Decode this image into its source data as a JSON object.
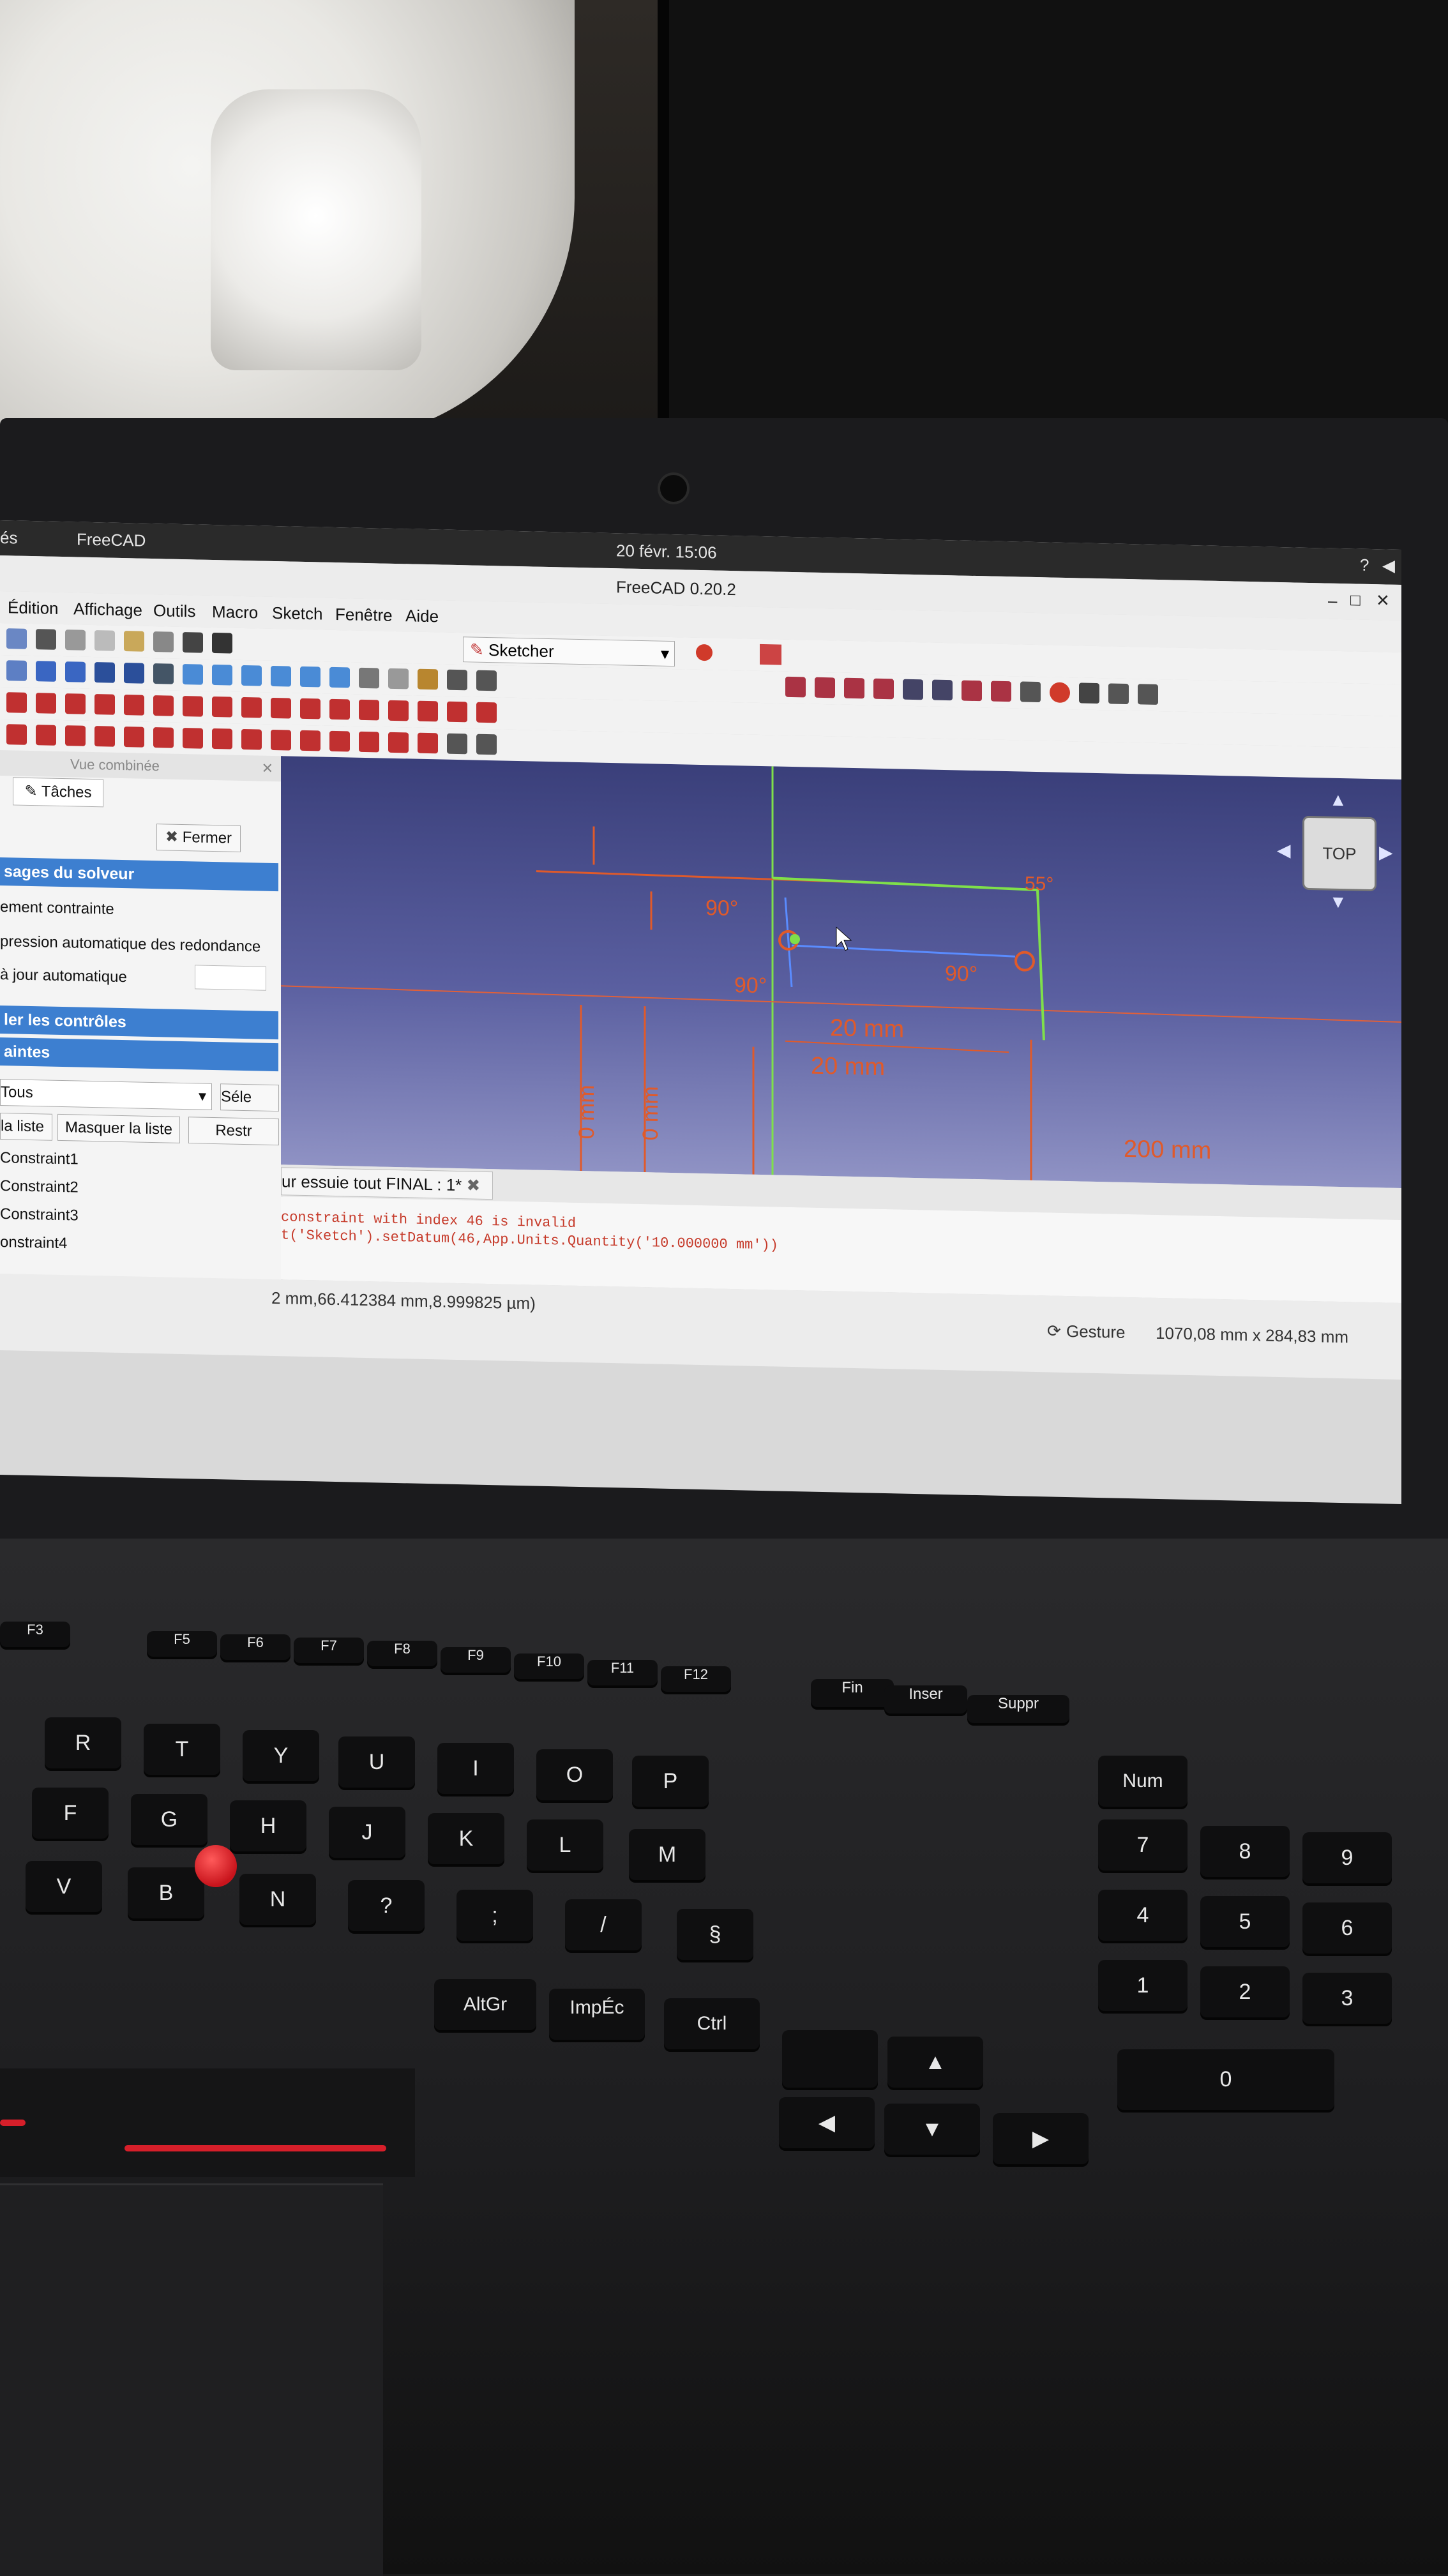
{
  "topbar": {
    "app_name": "FreeCAD",
    "left_fragment": "és",
    "clock": "20 févr.  15:06"
  },
  "window": {
    "title": "FreeCAD 0.20.2"
  },
  "menu": [
    "Édition",
    "Affichage",
    "Outils",
    "Macro",
    "Sketch",
    "Fenêtre",
    "Aide"
  ],
  "workbench": "Sketcher",
  "panel": {
    "header": "Vue combinée",
    "tab": "Tâches",
    "close_button": "Fermer",
    "solver_section": "sages du solveur",
    "line1": "ement contrainte",
    "line2": "pression automatique des redondance",
    "line3": "à jour automatique",
    "controls_section": "ler les contrôles",
    "constraints_section": "aintes",
    "filter": "Tous",
    "select_button": "Séle",
    "list_button": "la liste",
    "hide_button": "Masquer la liste",
    "restrict_button": "Restr",
    "constraints": [
      "Constraint1",
      "Constraint2",
      "Constraint3",
      "onstraint4"
    ]
  },
  "viewport": {
    "navcube": "TOP",
    "labels": [
      "90°",
      "90°",
      "90°",
      "20 mm",
      "20 mm",
      "200 mm",
      "0 mm",
      "0 mm",
      "55°"
    ]
  },
  "doc_tab": "ur essuie tout FINAL : 1*",
  "console": {
    "line1": "constraint with index 46 is invalid",
    "line2": "t('Sketch').setDatum(46,App.Units.Quantity('10.000000 mm'))"
  },
  "status": {
    "coords": "2 mm,66.412384 mm,8.999825 µm)",
    "nav_mode": "Gesture",
    "dimensions": "1070,08 mm x 284,83 mm"
  },
  "keyboard": {
    "fn_row": [
      "F3",
      "F5",
      "F6",
      "F7",
      "F8",
      "F9",
      "F10",
      "F11",
      "F12",
      "Fin",
      "Inser",
      "Suppr"
    ],
    "row_r": [
      "R",
      "T",
      "Y",
      "U",
      "I",
      "O",
      "P"
    ],
    "row_f": [
      "F",
      "G",
      "H",
      "J",
      "K",
      "L",
      "M"
    ],
    "row_v": [
      "V",
      "B",
      "N",
      "?",
      ";",
      "/",
      "§"
    ],
    "bottom": [
      "AltGr",
      "ImpÉc",
      "Ctrl"
    ],
    "numpad": [
      "Num",
      "7",
      "8",
      "9",
      "4",
      "5",
      "6",
      "1",
      "2",
      "3",
      "0"
    ]
  }
}
